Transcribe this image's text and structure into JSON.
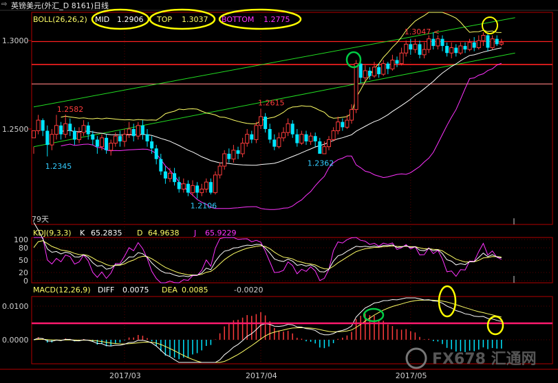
{
  "window": {
    "title": "英镑美元(外汇_D 8161)日线"
  },
  "colors": {
    "background": "#000000",
    "axis": "#b40000",
    "grid": "#5a0000",
    "bull": "#ff3c3c",
    "bear": "#00e5ff",
    "text_axis": "#d0d0d0",
    "mid": "#ffffff",
    "top": "#ffff66",
    "bottom": "#ff33ff",
    "k": "#ffffff",
    "d": "#ffff66",
    "j": "#ff33ff",
    "diff": "#ffffff",
    "dea": "#ffff66",
    "hist_pos": "#ff3c3c",
    "hist_neg": "#00e5ff",
    "trendline": "#22dd22",
    "hline_red": "#ff2020",
    "hline_magenta": "#ff1a6e",
    "annot_yellow": "#ffff00",
    "annot_green": "#00cc44",
    "annot_low": "#33ccff",
    "annot_high": "#ff3c3c",
    "legend_label": "#ffff66",
    "watermark": "#666666"
  },
  "boll_legend": {
    "name": "BOLL(26,26,2)",
    "mid_label": "MID",
    "mid_value": "1.2906",
    "top_label": "TOP",
    "top_value": "1.3037",
    "bottom_label": "BOTTOM",
    "bottom_value": "1.2775"
  },
  "kdj_legend": {
    "name": "KDJ(9,3,3)",
    "k_label": "K",
    "k_value": "65.2835",
    "d_label": "D",
    "d_value": "64.9638",
    "j_label": "J",
    "j_value": "65.9229"
  },
  "macd_legend": {
    "name": "MACD(12,26,9)",
    "diff_label": "DIFF",
    "diff_value": "0.0075",
    "dea_label": "DEA",
    "dea_value": "0.0085",
    "macd_value": "-0.0020"
  },
  "price_annotations": {
    "high_a": "1.2582",
    "low_a": "1.2345",
    "high_b": "1.2615",
    "low_b": "1.2106",
    "low_c": "1.2362",
    "high_c": "1.3047",
    "period_label": "79天"
  },
  "watermark": {
    "text": "FX678 汇通网"
  },
  "chart_data": [
    {
      "type": "candlestick",
      "title": "英镑美元(外汇_D 8161)日线",
      "y_ticks": [
        "1.3000",
        "1.2500"
      ],
      "ylim": [
        1.196,
        1.316
      ],
      "x_tick_labels": [
        "2017/03",
        "2017/04",
        "2017/05"
      ],
      "annotations": [
        "1.2582",
        "1.2345",
        "1.2615",
        "1.2106",
        "1.2362",
        "1.3047",
        "79天"
      ],
      "candles": [
        [
          1.245,
          1.249,
          1.24,
          1.236
        ],
        [
          1.249,
          1.255,
          1.258,
          1.247
        ],
        [
          1.255,
          1.249,
          1.256,
          1.246
        ],
        [
          1.249,
          1.241,
          1.252,
          1.2345
        ],
        [
          1.241,
          1.247,
          1.25,
          1.238
        ],
        [
          1.247,
          1.252,
          1.258,
          1.244
        ],
        [
          1.252,
          1.247,
          1.254,
          1.244
        ],
        [
          1.247,
          1.253,
          1.2582,
          1.245
        ],
        [
          1.253,
          1.249,
          1.256,
          1.246
        ],
        [
          1.249,
          1.244,
          1.251,
          1.241
        ],
        [
          1.244,
          1.248,
          1.251,
          1.242
        ],
        [
          1.248,
          1.252,
          1.255,
          1.246
        ],
        [
          1.252,
          1.247,
          1.254,
          1.244
        ],
        [
          1.247,
          1.244,
          1.249,
          1.241
        ],
        [
          1.244,
          1.24,
          1.246,
          1.236
        ],
        [
          1.24,
          1.245,
          1.247,
          1.238
        ],
        [
          1.245,
          1.238,
          1.247,
          1.236
        ],
        [
          1.238,
          1.242,
          1.244,
          1.235
        ],
        [
          1.242,
          1.246,
          1.248,
          1.24
        ],
        [
          1.246,
          1.243,
          1.249,
          1.24
        ],
        [
          1.243,
          1.247,
          1.25,
          1.24
        ],
        [
          1.247,
          1.25,
          1.254,
          1.245
        ],
        [
          1.25,
          1.246,
          1.253,
          1.243
        ],
        [
          1.246,
          1.252,
          1.254,
          1.244
        ],
        [
          1.252,
          1.247,
          1.255,
          1.244
        ],
        [
          1.247,
          1.243,
          1.25,
          1.24
        ],
        [
          1.243,
          1.239,
          1.246,
          1.236
        ],
        [
          1.239,
          1.233,
          1.241,
          1.23
        ],
        [
          1.233,
          1.226,
          1.236,
          1.224
        ],
        [
          1.226,
          1.222,
          1.229,
          1.219
        ],
        [
          1.222,
          1.225,
          1.228,
          1.22
        ],
        [
          1.225,
          1.22,
          1.228,
          1.218
        ],
        [
          1.22,
          1.216,
          1.223,
          1.214
        ],
        [
          1.216,
          1.219,
          1.222,
          1.214
        ],
        [
          1.219,
          1.214,
          1.221,
          1.212
        ],
        [
          1.214,
          1.218,
          1.221,
          1.212
        ],
        [
          1.218,
          1.214,
          1.22,
          1.2106
        ],
        [
          1.214,
          1.216,
          1.219,
          1.212
        ],
        [
          1.216,
          1.22,
          1.222,
          1.214
        ],
        [
          1.22,
          1.214,
          1.222,
          1.213
        ],
        [
          1.214,
          1.224,
          1.226,
          1.213
        ],
        [
          1.224,
          1.229,
          1.231,
          1.222
        ],
        [
          1.229,
          1.236,
          1.238,
          1.227
        ],
        [
          1.236,
          1.233,
          1.239,
          1.231
        ],
        [
          1.233,
          1.238,
          1.241,
          1.231
        ],
        [
          1.238,
          1.236,
          1.24,
          1.233
        ],
        [
          1.236,
          1.242,
          1.245,
          1.234
        ],
        [
          1.242,
          1.247,
          1.25,
          1.24
        ],
        [
          1.247,
          1.244,
          1.249,
          1.242
        ],
        [
          1.244,
          1.252,
          1.254,
          1.242
        ],
        [
          1.252,
          1.257,
          1.2615,
          1.25
        ],
        [
          1.257,
          1.25,
          1.259,
          1.248
        ],
        [
          1.25,
          1.244,
          1.253,
          1.242
        ],
        [
          1.244,
          1.24,
          1.247,
          1.238
        ],
        [
          1.24,
          1.245,
          1.248,
          1.239
        ],
        [
          1.245,
          1.248,
          1.251,
          1.243
        ],
        [
          1.248,
          1.253,
          1.256,
          1.246
        ],
        [
          1.253,
          1.247,
          1.255,
          1.245
        ],
        [
          1.247,
          1.242,
          1.25,
          1.24
        ],
        [
          1.242,
          1.247,
          1.249,
          1.241
        ],
        [
          1.247,
          1.243,
          1.249,
          1.241
        ],
        [
          1.243,
          1.246,
          1.248,
          1.241
        ],
        [
          1.246,
          1.243,
          1.248,
          1.24
        ],
        [
          1.243,
          1.236,
          1.245,
          1.2362
        ],
        [
          1.236,
          1.24,
          1.243,
          1.236
        ],
        [
          1.24,
          1.244,
          1.246,
          1.238
        ],
        [
          1.244,
          1.249,
          1.251,
          1.243
        ],
        [
          1.249,
          1.254,
          1.257,
          1.247
        ],
        [
          1.254,
          1.251,
          1.256,
          1.249
        ],
        [
          1.251,
          1.255,
          1.258,
          1.25
        ],
        [
          1.255,
          1.261,
          1.264,
          1.253
        ],
        [
          1.261,
          1.287,
          1.289,
          1.259
        ],
        [
          1.287,
          1.279,
          1.29,
          1.276
        ],
        [
          1.279,
          1.283,
          1.286,
          1.277
        ],
        [
          1.283,
          1.28,
          1.285,
          1.278
        ],
        [
          1.28,
          1.285,
          1.288,
          1.279
        ],
        [
          1.285,
          1.281,
          1.287,
          1.279
        ],
        [
          1.281,
          1.287,
          1.289,
          1.28
        ],
        [
          1.287,
          1.284,
          1.288,
          1.281
        ],
        [
          1.284,
          1.289,
          1.292,
          1.283
        ],
        [
          1.289,
          1.287,
          1.291,
          1.285
        ],
        [
          1.287,
          1.293,
          1.296,
          1.286
        ],
        [
          1.293,
          1.298,
          1.3,
          1.291
        ],
        [
          1.298,
          1.295,
          1.301,
          1.292
        ],
        [
          1.295,
          1.298,
          1.301,
          1.293
        ],
        [
          1.298,
          1.292,
          1.3,
          1.29
        ],
        [
          1.292,
          1.295,
          1.299,
          1.29
        ],
        [
          1.295,
          1.301,
          1.303,
          1.293
        ],
        [
          1.301,
          1.297,
          1.3047,
          1.295
        ],
        [
          1.297,
          1.301,
          1.303,
          1.295
        ],
        [
          1.301,
          1.297,
          1.303,
          1.294
        ],
        [
          1.297,
          1.293,
          1.299,
          1.291
        ],
        [
          1.293,
          1.296,
          1.299,
          1.29
        ],
        [
          1.296,
          1.293,
          1.298,
          1.291
        ],
        [
          1.293,
          1.297,
          1.299,
          1.292
        ],
        [
          1.297,
          1.295,
          1.299,
          1.293
        ],
        [
          1.295,
          1.299,
          1.301,
          1.294
        ],
        [
          1.299,
          1.296,
          1.302,
          1.294
        ],
        [
          1.296,
          1.3,
          1.303,
          1.295
        ],
        [
          1.3,
          1.303,
          1.3047,
          1.297
        ],
        [
          1.303,
          1.296,
          1.304,
          1.294
        ],
        [
          1.296,
          1.301,
          1.303,
          1.295
        ],
        [
          1.301,
          1.298,
          1.303,
          1.297
        ],
        [
          1.298,
          1.299,
          1.301,
          1.297
        ]
      ],
      "candle_order": "open, close, high, low",
      "guide_levels": [
        1.2995,
        1.2865,
        1.2755
      ],
      "trend_channel": {
        "upper": [
          [
            0,
            1.2625
          ],
          [
            106,
            1.313
          ]
        ],
        "lower": [
          [
            0,
            1.24
          ],
          [
            106,
            1.293
          ]
        ]
      }
    },
    {
      "type": "line",
      "title": "KDJ(9,3,3)",
      "y_ticks": [
        0,
        20,
        50,
        80,
        100
      ],
      "ylim": [
        0,
        100
      ],
      "series": [
        {
          "name": "K",
          "values": [
            65.2835
          ]
        },
        {
          "name": "D",
          "values": [
            64.9638
          ]
        },
        {
          "name": "J",
          "values": [
            65.9229
          ]
        }
      ]
    },
    {
      "type": "bar",
      "title": "MACD(12,26,9)",
      "y_ticks": [
        "0.0100",
        "0.0000"
      ],
      "series": [
        {
          "name": "DIFF",
          "values": [
            0.0075
          ]
        },
        {
          "name": "DEA",
          "values": [
            0.0085
          ]
        },
        {
          "name": "MACD",
          "values": [
            -0.002
          ]
        }
      ]
    }
  ]
}
